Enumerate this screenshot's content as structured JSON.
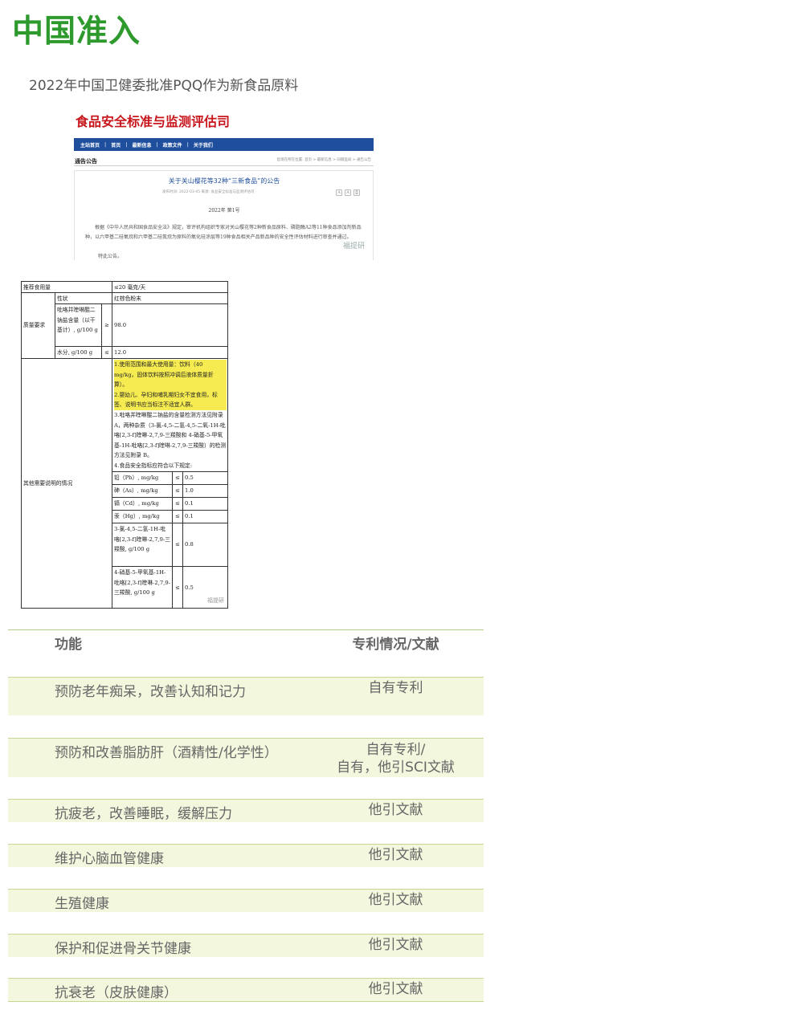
{
  "heading": "中国准入",
  "subtitle": "2022年中国卫健委批准PQQ作为新食品原料",
  "notice": {
    "department": "食品安全标准与监测评估司",
    "nav": [
      "主站首页",
      "首页",
      "最新信息",
      "政策文件",
      "关于我们"
    ],
    "section": "通告公告",
    "breadcrumb": "您现在所在位置:  首页  >  最新信息  >  间隔监局  >  通告公告",
    "title": "关于关山樱花等32种“三新食品”的公告",
    "meta": "发布时间:  2022-03-05     来源: 食品安全标准与监测评估司",
    "issue": "2022年   第1号",
    "paragraph": "根据《中华人民共和国食品安全法》规定，审评机构组织专家对关山樱花等2种新食品原料、磷脂酶A2等11种食品添加剂新品种，以六甲基二硅氧烷和六甲基二硅氮烷为原料的氧化硅涂层等19种食品相关产品新品种的安全性评估材料进行审查并通过。",
    "closing": "特此公告。",
    "watermark": "福提研"
  },
  "spec": {
    "intake_label": "推荐食用量",
    "intake_value": "≤20 毫克/天",
    "quality_label": "质量要求",
    "appearance_label": "性状",
    "appearance_value": "红棕色粉末",
    "content_label": "吡咯并喹啉醌二钠盐含量（以干基计）, g/100 g",
    "content_op": "≥",
    "content_value": "98.0",
    "moisture_label": "水分, g/100 g",
    "moisture_op": "≤",
    "moisture_value": "12.0",
    "other_label": "其他需要说明的情况",
    "note1": "1.使用范围和最大使用量：饮料（40 mg/kg，固体饮料按照冲调后液体质量折算）。",
    "note2": "2.婴幼儿、孕妇和哺乳期妇女不宜食用，标签、说明书应当标注不适宜人群。",
    "note3": "3.吡咯并喹啉醌二钠盐的含量检测方法见附录 A，两种杂质（3-氯-4,5-二氢-4,5-二氧-1H-吡咯[2,3-f]喹啉-2,7,9-三羧酸和 4-硝基-5-甲氧基-1H-吡咯[2,3-f]喹啉-2,7,9-三羧酸）的检测方法见附录 B。",
    "note4": "4.食品安全指标应符合以下规定:",
    "limits": [
      {
        "item": "铅（Pb）, mg/kg",
        "op": "≤",
        "value": "0.5"
      },
      {
        "item": "砷（As）, mg/kg",
        "op": "≤",
        "value": "1.0"
      },
      {
        "item": "镉（Cd）, mg/kg",
        "op": "≤",
        "value": "0.1"
      },
      {
        "item": "汞（Hg）, mg/kg",
        "op": "≤",
        "value": "0.1"
      },
      {
        "item": "3-氯-4,5-二氢-1H-吡咯[2,3-f]喹啉-2,7,9-三羧酸, g/100 g",
        "op": "≤",
        "value": "0.8"
      },
      {
        "item": "4-硝基-5-甲氧基-1H-吡咯[2,3-f]喹啉-2,7,9-三羧酸, g/100 g",
        "op": "≤",
        "value": "0.5"
      }
    ],
    "watermark": "福提研"
  },
  "functions": {
    "headers": {
      "function": "功能",
      "patent": "专利情况/文献"
    },
    "rows": [
      {
        "function": "预防老年痴呆，改善认知和记力",
        "patent": "自有专利"
      },
      {
        "function": "预防和改善脂肪肝（酒精性/化学性）",
        "patent": "自有专利/\n自有，他引SCI文献"
      },
      {
        "function": "抗疲老，改善睡眠，缓解压力",
        "patent": "他引文献"
      },
      {
        "function": "维护心脑血管健康",
        "patent": "他引文献"
      },
      {
        "function": "生殖健康",
        "patent": "他引文献"
      },
      {
        "function": "保护和促进骨关节健康",
        "patent": "他引文献"
      },
      {
        "function": "抗衰老（皮肤健康）",
        "patent": "他引文献"
      }
    ]
  }
}
